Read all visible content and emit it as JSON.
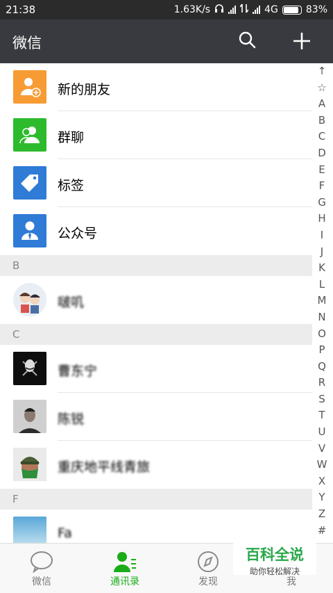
{
  "status_bar": {
    "time": "21:38",
    "speed": "1.63K/s",
    "network": "4G",
    "battery": "83%",
    "battery_level": 0.83
  },
  "header": {
    "title": "微信"
  },
  "top_items": [
    {
      "label": "新的朋友",
      "icon": "new-friends-icon",
      "color": "#f79c34"
    },
    {
      "label": "群聊",
      "icon": "group-chat-icon",
      "color": "#2dbb2d"
    },
    {
      "label": "标签",
      "icon": "tag-icon",
      "color": "#2f7bd6"
    },
    {
      "label": "公众号",
      "icon": "official-account-icon",
      "color": "#2f7bd6"
    }
  ],
  "sections": [
    {
      "letter": "B",
      "contacts": [
        {
          "name": "啵叽"
        }
      ]
    },
    {
      "letter": "C",
      "contacts": [
        {
          "name": "曹东宁"
        },
        {
          "name": "陈锐"
        },
        {
          "name": "重庆地平线青旅"
        }
      ]
    },
    {
      "letter": "F",
      "contacts": [
        {
          "name": "Fa"
        }
      ]
    }
  ],
  "alphabet": [
    "↑",
    "☆",
    "A",
    "B",
    "C",
    "D",
    "E",
    "F",
    "G",
    "H",
    "I",
    "J",
    "K",
    "L",
    "M",
    "N",
    "O",
    "P",
    "Q",
    "R",
    "S",
    "T",
    "U",
    "V",
    "W",
    "X",
    "Y",
    "Z",
    "#"
  ],
  "bottom_nav": [
    {
      "label": "微信",
      "icon": "chat-bubble-icon"
    },
    {
      "label": "通讯录",
      "icon": "contacts-icon",
      "active": true
    },
    {
      "label": "发现",
      "icon": "compass-icon"
    },
    {
      "label": "我",
      "icon": "me-icon"
    }
  ],
  "watermark": {
    "brand": "百科全说",
    "tagline": "助你轻松解决"
  },
  "colors": {
    "accent": "#1aad19",
    "header_bg": "#393a3f",
    "status_bg": "#2b2b2b"
  }
}
